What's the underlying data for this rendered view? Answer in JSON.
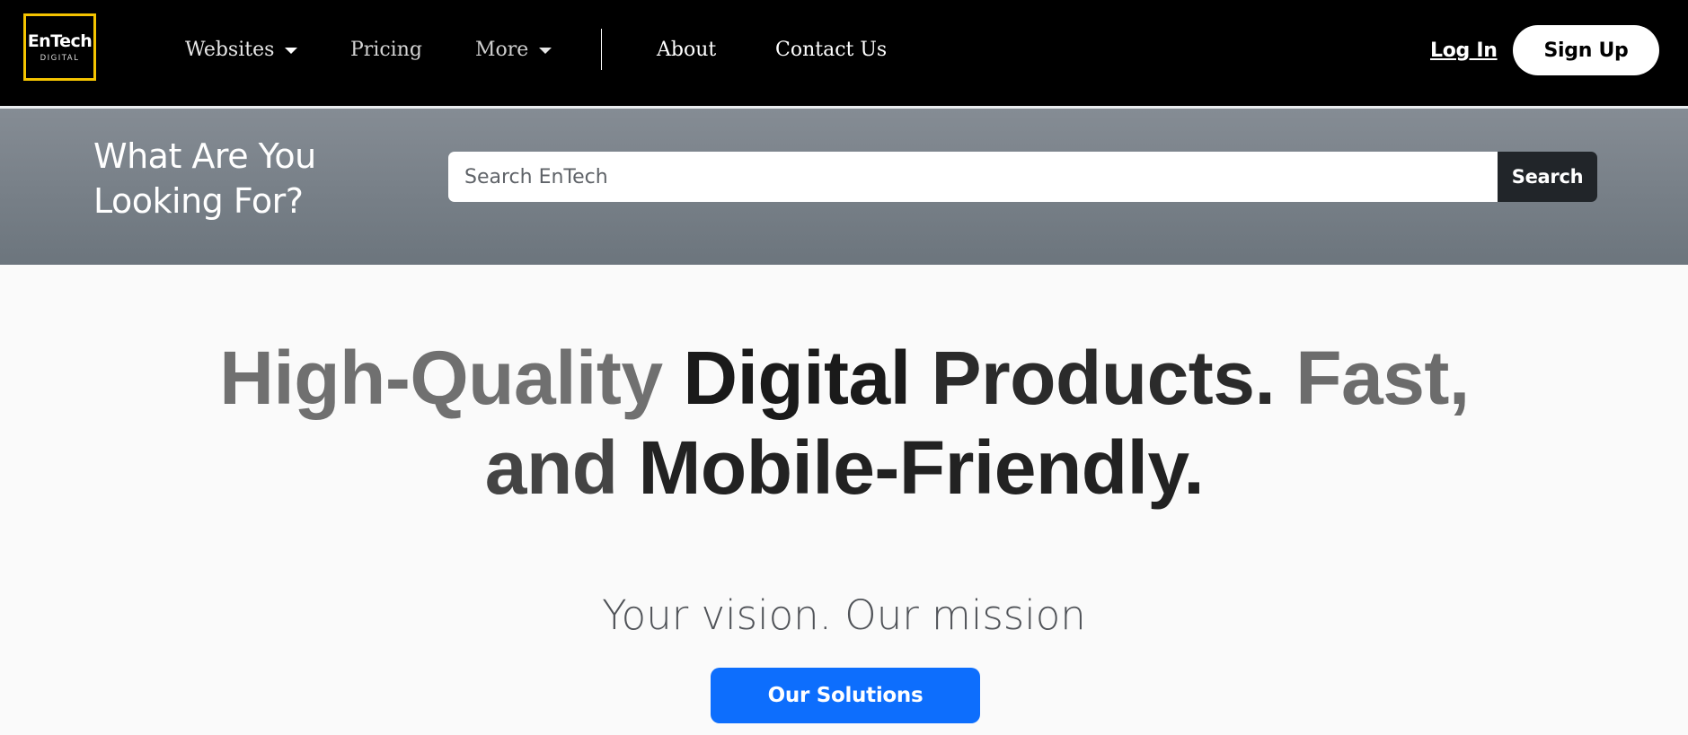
{
  "brand": {
    "logo_main": "EnTech",
    "logo_sub": "DIGITAL",
    "accent_color": "#f5c400"
  },
  "nav": {
    "websites": "Websites",
    "pricing": "Pricing",
    "more": "More",
    "about": "About",
    "contact": "Contact Us",
    "login": "Log In",
    "signup": "Sign Up"
  },
  "search": {
    "heading": "What Are You Looking For?",
    "placeholder": "Search EnTech",
    "button": "Search"
  },
  "hero": {
    "title_words": [
      "High-Quality",
      "Digital",
      "Products.",
      "Fast,",
      "and",
      "Mobile-Friendly."
    ],
    "subtitle": "Your vision. Our mission",
    "cta": "Our Solutions",
    "cta_color": "#0d6efd"
  }
}
